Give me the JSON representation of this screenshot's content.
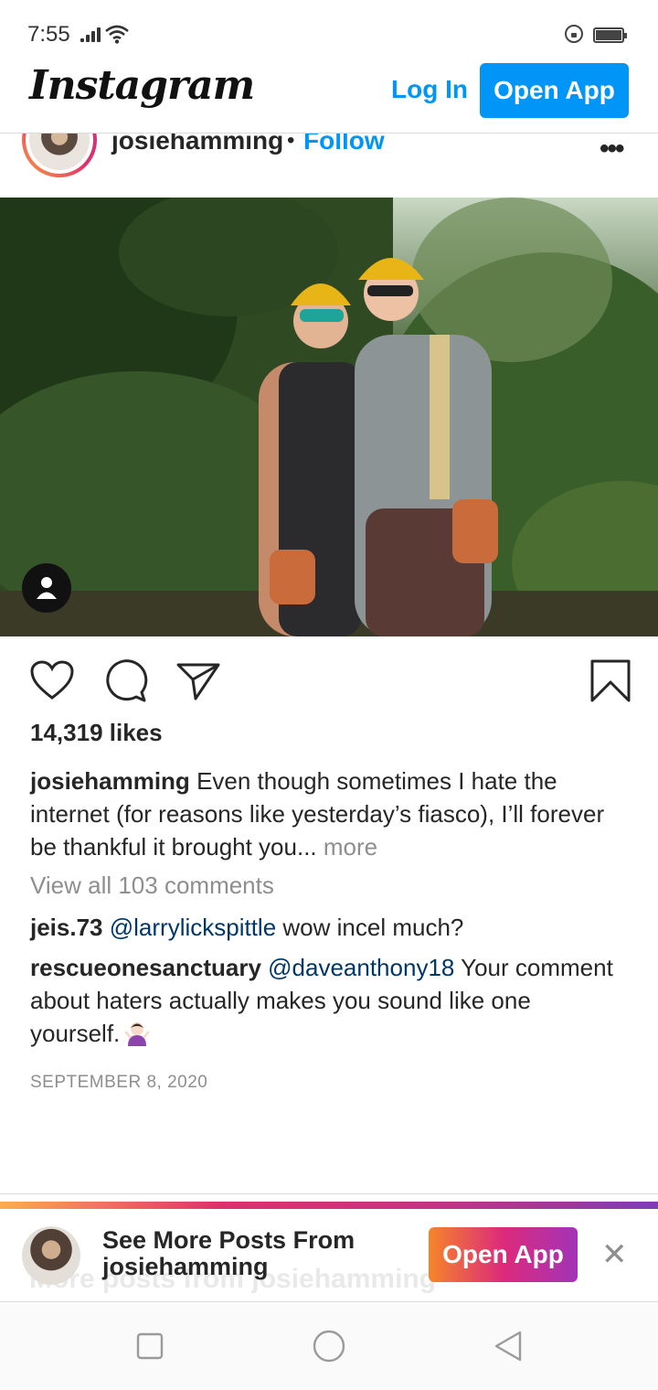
{
  "status_bar": {
    "time": "7:55"
  },
  "header": {
    "logo": "Instagram",
    "login_label": "Log In",
    "open_app_label": "Open App"
  },
  "post": {
    "username": "josiehamming",
    "separator": "•",
    "follow_label": "Follow",
    "more_icon": "ellipsis-icon",
    "likes": "14,319 likes",
    "caption": {
      "username": "josiehamming",
      "text": "Even though sometimes I hate the internet (for reasons like yesterday’s fiasco), I’ll forever be thankful it brought you...",
      "more": "more"
    },
    "view_comments": "View all 103 comments",
    "comments": [
      {
        "username": "jeis.73",
        "mention": "@larrylickspittle",
        "text": "wow incel much?"
      },
      {
        "username": "rescueonesanctuary",
        "mention": "@daveanthony18",
        "text": "Your comment about haters actually makes you sound like one yourself."
      }
    ],
    "date": "SEPTEMBER 8, 2020"
  },
  "banner": {
    "title_line1": "See More Posts From",
    "title_line2": "josiehamming",
    "ghost_text": "More posts from josiehamming",
    "open_app_label": "Open App"
  },
  "colors": {
    "accent": "#0095f6",
    "text": "#262626",
    "muted": "#8e8e8e",
    "mention": "#00376b"
  }
}
